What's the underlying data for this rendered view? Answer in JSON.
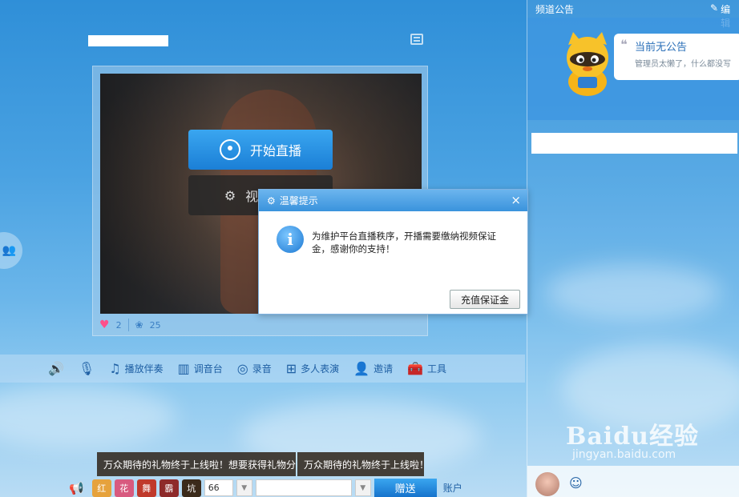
{
  "colors": {
    "accent": "#1b7fd6",
    "dialog_header": "#3a93dc",
    "heart": "#ff4f8b"
  },
  "room": {
    "title": "",
    "menu_icon": "list-icon"
  },
  "video": {
    "start_live_label": "开始直播",
    "settings_label": "视频设置",
    "likes": "2",
    "flowers": "25"
  },
  "dialog": {
    "title": "温馨提示",
    "message": "为维护平台直播秩序，开播需要缴纳视频保证金，感谢你的支持！",
    "button": "充值保证金",
    "close": "×"
  },
  "toolbar": {
    "items": [
      {
        "icon": "speaker-icon",
        "label": ""
      },
      {
        "icon": "microphone-icon",
        "label": ""
      },
      {
        "icon": "music-icon",
        "label": "播放伴奏"
      },
      {
        "icon": "mixer-icon",
        "label": "调音台"
      },
      {
        "icon": "record-icon",
        "label": "录音"
      },
      {
        "icon": "grid-icon",
        "label": "多人表演"
      },
      {
        "icon": "invite-icon",
        "label": "邀请"
      },
      {
        "icon": "toolbox-icon",
        "label": "工具"
      }
    ]
  },
  "tooltips": [
    "万众期待的礼物终于上线啦！想要获得礼物分",
    "万众期待的礼物终于上线啦！"
  ],
  "gift_bar": {
    "count": "66",
    "send": "赠送",
    "account": "账户",
    "gift_icons": [
      "红",
      "花",
      "舞",
      "霸",
      "坑"
    ]
  },
  "right": {
    "notice_title": "频道公告",
    "edit_label": "编辑",
    "notice_head": "当前无公告",
    "notice_sub": "管理员太懒了，什么都没写"
  },
  "watermark": {
    "line1": "Baidu经验",
    "line2": "jingyan.baidu.com"
  }
}
